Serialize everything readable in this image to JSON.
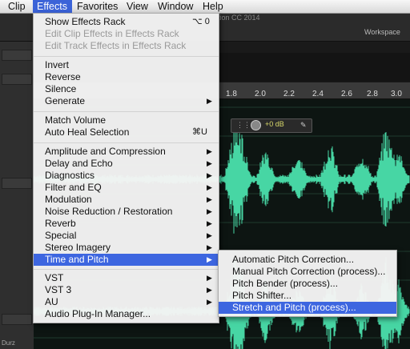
{
  "menubar": {
    "items": [
      "Clip",
      "Effects",
      "Favorites",
      "View",
      "Window",
      "Help"
    ],
    "active_index": 1
  },
  "app": {
    "title_fragment": "tion CC 2014",
    "workspace_label": "Workspace",
    "footer_label": "Durz",
    "hud_value": "+0 dB",
    "ruler_ticks": [
      "1.8",
      "2.0",
      "2.2",
      "2.4",
      "2.6",
      "2.8",
      "3.0"
    ]
  },
  "effects_menu": {
    "items": [
      {
        "label": "Show Effects Rack",
        "shortcut": "⌥ 0",
        "enabled": true,
        "submenu": false
      },
      {
        "label": "Edit Clip Effects in Effects Rack",
        "enabled": false,
        "submenu": false
      },
      {
        "label": "Edit Track Effects in Effects Rack",
        "enabled": false,
        "submenu": false
      },
      {
        "label": "Invert",
        "enabled": true,
        "submenu": false
      },
      {
        "label": "Reverse",
        "enabled": true,
        "submenu": false
      },
      {
        "label": "Silence",
        "enabled": true,
        "submenu": false
      },
      {
        "label": "Generate",
        "enabled": true,
        "submenu": true
      },
      {
        "label": "Match Volume",
        "enabled": true,
        "submenu": false
      },
      {
        "label": "Auto Heal Selection",
        "shortcut": "⌘U",
        "enabled": true,
        "submenu": false
      },
      {
        "label": "Amplitude and Compression",
        "enabled": true,
        "submenu": true
      },
      {
        "label": "Delay and Echo",
        "enabled": true,
        "submenu": true
      },
      {
        "label": "Diagnostics",
        "enabled": true,
        "submenu": true
      },
      {
        "label": "Filter and EQ",
        "enabled": true,
        "submenu": true
      },
      {
        "label": "Modulation",
        "enabled": true,
        "submenu": true
      },
      {
        "label": "Noise Reduction / Restoration",
        "enabled": true,
        "submenu": true
      },
      {
        "label": "Reverb",
        "enabled": true,
        "submenu": true
      },
      {
        "label": "Special",
        "enabled": true,
        "submenu": true
      },
      {
        "label": "Stereo Imagery",
        "enabled": true,
        "submenu": true
      },
      {
        "label": "Time and Pitch",
        "enabled": true,
        "submenu": true,
        "highlighted": true
      },
      {
        "label": "VST",
        "enabled": true,
        "submenu": true
      },
      {
        "label": "VST 3",
        "enabled": true,
        "submenu": true
      },
      {
        "label": "AU",
        "enabled": true,
        "submenu": true
      },
      {
        "label": "Audio Plug-In Manager...",
        "enabled": true,
        "submenu": false
      }
    ]
  },
  "time_pitch_submenu": {
    "items": [
      {
        "label": "Automatic Pitch Correction..."
      },
      {
        "label": "Manual Pitch Correction (process)..."
      },
      {
        "label": "Pitch Bender (process)..."
      },
      {
        "label": "Pitch Shifter..."
      },
      {
        "label": "Stretch and Pitch (process)...",
        "highlighted": true
      }
    ]
  },
  "colors": {
    "highlight": "#3d66e0",
    "waveform": "#47d6a4",
    "hud_text": "#d8d86a"
  },
  "icons": {
    "arrow": "▶"
  }
}
